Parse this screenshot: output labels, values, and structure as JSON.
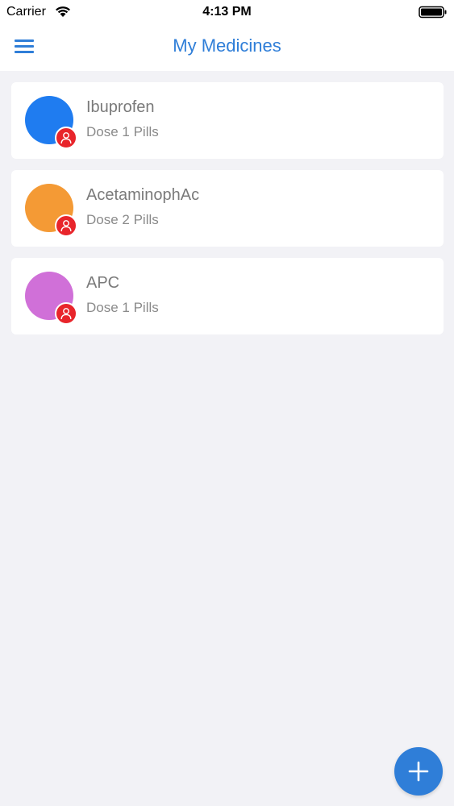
{
  "status_bar": {
    "carrier": "Carrier",
    "time": "4:13 PM"
  },
  "nav": {
    "title": "My Medicines",
    "menu_icon": "hamburger-menu-icon"
  },
  "colors": {
    "accent": "#2f7ed8",
    "badge": "#e8252b"
  },
  "medicines": [
    {
      "name": "Ibuprofen",
      "dose": "Dose 1 Pills",
      "color": "#1f7cf0",
      "badge_icon": "user-icon"
    },
    {
      "name": "AcetaminophAc",
      "dose": "Dose 2 Pills",
      "color": "#f49a35",
      "badge_icon": "user-icon"
    },
    {
      "name": "APC",
      "dose": "Dose 1 Pills",
      "color": "#d070d8",
      "badge_icon": "user-icon"
    }
  ],
  "fab": {
    "icon": "plus-icon"
  }
}
